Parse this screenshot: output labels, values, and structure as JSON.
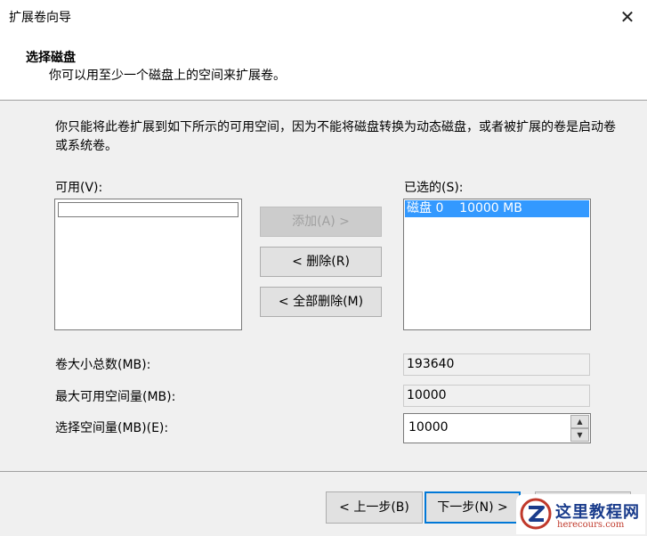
{
  "window": {
    "title": "扩展卷向导"
  },
  "header": {
    "title": "选择磁盘",
    "subtitle": "你可以用至少一个磁盘上的空间来扩展卷。"
  },
  "main": {
    "description": "你只能将此卷扩展到如下所示的可用空间，因为不能将磁盘转换为动态磁盘，或者被扩展的卷是启动卷或系统卷。",
    "available_label": "可用(V):",
    "selected_label": "已选的(S):",
    "selected_items": [
      {
        "disk": "磁盘 0",
        "size": "10000 MB"
      }
    ],
    "buttons": {
      "add": "添加(A) >",
      "remove": "< 删除(R)",
      "remove_all": "< 全部删除(M)"
    },
    "fields": {
      "total_label": "卷大小总数(MB):",
      "total_value": "193640",
      "max_label": "最大可用空间量(MB):",
      "max_value": "10000",
      "select_label": "选择空间量(MB)(E):",
      "select_value": "10000"
    }
  },
  "footer": {
    "back": "< 上一步(B)",
    "next": "下一步(N) >"
  },
  "watermark": {
    "text": "这里教程网",
    "url": "herecours.com"
  },
  "colors": {
    "selection": "#3399ff",
    "default_border": "#0078d7",
    "panel": "#f0f0f0"
  }
}
